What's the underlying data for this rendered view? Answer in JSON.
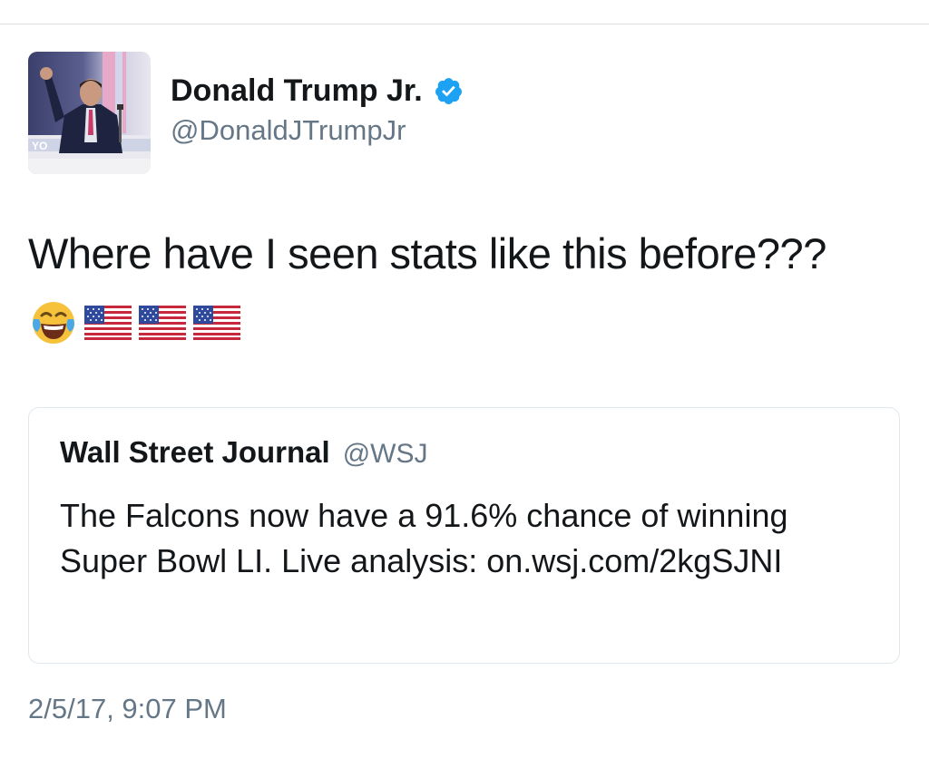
{
  "tweet": {
    "author": {
      "display_name": "Donald Trump Jr.",
      "handle": "@DonaldJTrumpJr",
      "verified": true,
      "avatar_icon": "profile-photo"
    },
    "text": "Where have I seen stats like this before???",
    "emojis": [
      "face-with-tears-of-joy",
      "us-flag",
      "us-flag",
      "us-flag"
    ],
    "timestamp": "2/5/17, 9:07 PM"
  },
  "quoted_tweet": {
    "author": {
      "display_name": "Wall Street Journal",
      "handle": "@WSJ"
    },
    "text": "The Falcons now have a 91.6% chance of winning Super Bowl LI. Live analysis: on.wsj.com/2kgSJNI"
  },
  "colors": {
    "text_primary": "#14171a",
    "text_secondary": "#657786",
    "verified_blue": "#1da1f2",
    "border": "#e1e8ed"
  }
}
